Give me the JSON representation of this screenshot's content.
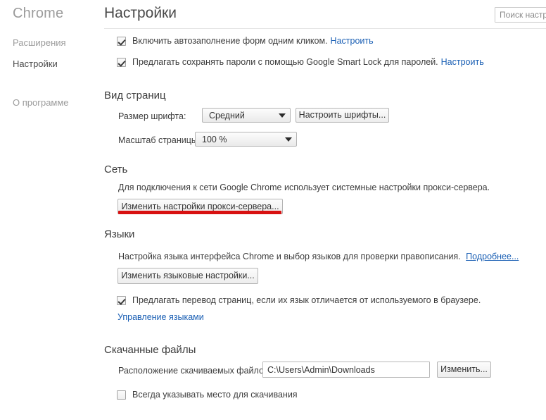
{
  "sidebar": {
    "brand": "Chrome",
    "items": [
      {
        "id": "extensions",
        "label": "Расширения",
        "active": false
      },
      {
        "id": "settings",
        "label": "Настройки",
        "active": true
      },
      {
        "id": "about",
        "label": "О программе",
        "active": false
      }
    ]
  },
  "header": {
    "title": "Настройки",
    "search_placeholder": "Поиск настр",
    "search_value": ""
  },
  "autofill": {
    "checkbox_label": "Включить автозаполнение форм одним кликом.",
    "link_label": "Настроить",
    "checked": true
  },
  "passwords": {
    "checkbox_label": "Предлагать сохранять пароли с помощью Google Smart Lock для паролей.",
    "link_label": "Настроить",
    "checked": true
  },
  "appearance": {
    "title": "Вид страниц",
    "font_size_label": "Размер шрифта:",
    "font_size_value": "Средний",
    "customize_fonts_button": "Настроить шрифты...",
    "page_zoom_label": "Масштаб страницы:",
    "page_zoom_value": "100 %"
  },
  "network": {
    "title": "Сеть",
    "description": "Для подключения к сети Google Chrome использует системные настройки прокси-сервера.",
    "proxy_button": "Изменить настройки прокси-сервера...",
    "highlight_color": "#d81111"
  },
  "languages": {
    "title": "Языки",
    "description": "Настройка языка интерфейса Chrome и выбор языков для проверки правописания.",
    "more_link": "Подробнее...",
    "change_button": "Изменить языковые настройки...",
    "translate_checkbox_label": "Предлагать перевод страниц, если их язык отличается от используемого в браузере.",
    "translate_checked": true,
    "manage_link": "Управление языками"
  },
  "downloads": {
    "title": "Скачанные файлы",
    "location_label": "Расположение скачиваемых файлов:",
    "location_value": "C:\\Users\\Admin\\Downloads",
    "change_button": "Изменить...",
    "ask_checkbox_label": "Всегда указывать место для скачивания",
    "ask_checked": false
  },
  "icons": {
    "dropdown": "chevron-down-icon",
    "checkmark": "check-icon"
  }
}
